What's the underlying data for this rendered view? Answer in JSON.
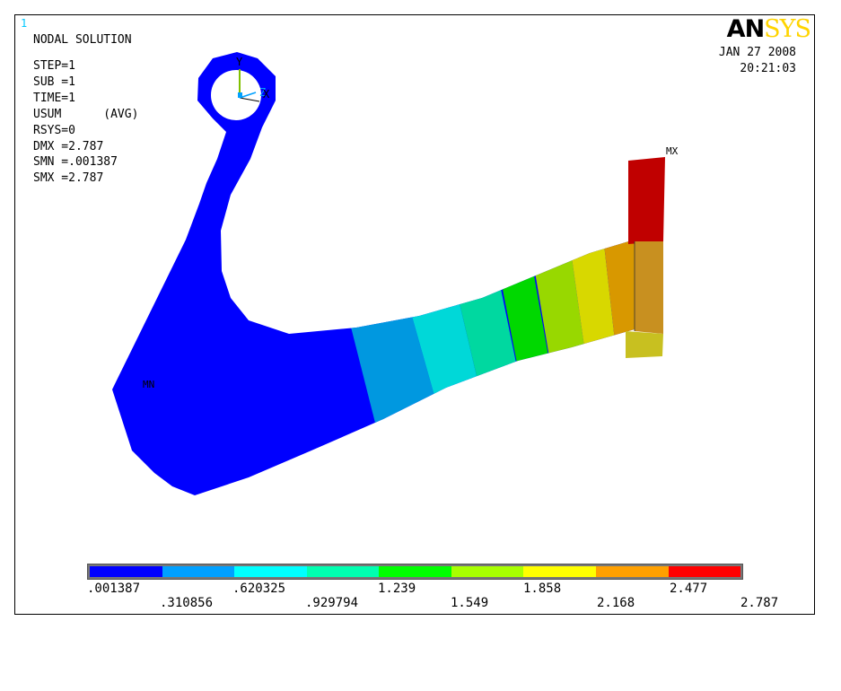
{
  "window_number": "1",
  "title": "NODAL SOLUTION",
  "info_lines": [
    "STEP=1",
    "SUB =1",
    "TIME=1",
    "USUM      (AVG)",
    "RSYS=0",
    "DMX =2.787",
    "SMN =.001387",
    "SMX =2.787"
  ],
  "logo": {
    "part1": "AN",
    "part2": "SYS"
  },
  "date": "JAN 27 2008",
  "time": "20:21:03",
  "markers": {
    "min": "MN",
    "max": "MX"
  },
  "axes": {
    "y": "Y",
    "x": "X",
    "z": "Z"
  },
  "legend": {
    "colors": [
      "#0000ff",
      "#00a0ff",
      "#00ffff",
      "#00ffb0",
      "#00ff00",
      "#a8ff00",
      "#ffff00",
      "#ffa000",
      "#ff0000"
    ],
    "labels_top": [
      ".001387",
      ".620325",
      "1.239",
      "1.858",
      "2.477"
    ],
    "labels_bottom": [
      ".310856",
      ".929794",
      "1.549",
      "2.168",
      "2.787"
    ]
  },
  "model_colors": {
    "c0": "#0000ff",
    "c1": "#0098e0",
    "c2": "#00d8d8",
    "c3": "#00d8a0",
    "c4": "#00d800",
    "c5": "#98d800",
    "c6": "#d8d800",
    "c7": "#d89800",
    "c8": "#c00000",
    "c_mid": "#c89020",
    "c_low": "#c8c020"
  }
}
